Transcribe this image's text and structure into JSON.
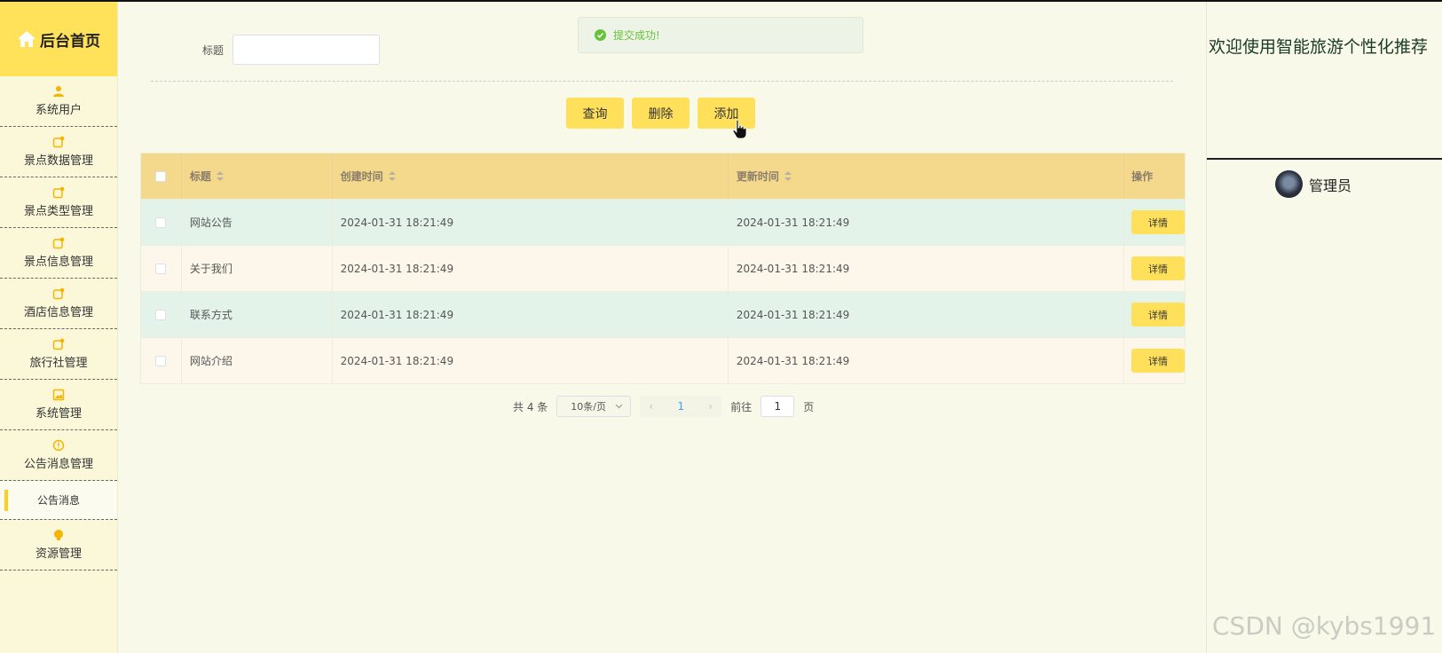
{
  "sidebar": {
    "brand": "后台首页",
    "items": [
      {
        "label": "系统用户",
        "icon": "user-icon"
      },
      {
        "label": "景点数据管理",
        "icon": "edit-icon"
      },
      {
        "label": "景点类型管理",
        "icon": "edit-icon"
      },
      {
        "label": "景点信息管理",
        "icon": "edit-icon"
      },
      {
        "label": "酒店信息管理",
        "icon": "edit-icon"
      },
      {
        "label": "旅行社管理",
        "icon": "edit-icon"
      },
      {
        "label": "系统管理",
        "icon": "image-icon"
      },
      {
        "label": "公告消息管理",
        "icon": "info-icon"
      }
    ],
    "active_sub": "公告消息",
    "last_item": {
      "label": "资源管理",
      "icon": "bulb-icon"
    }
  },
  "search": {
    "label": "标题",
    "value": ""
  },
  "toast": {
    "text": "提交成功!",
    "icon": "success-check-icon"
  },
  "buttons": {
    "query": "查询",
    "delete": "删除",
    "add": "添加"
  },
  "table": {
    "headers": [
      "标题",
      "创建时间",
      "更新时间",
      "操作"
    ],
    "rows": [
      {
        "title": "网站公告",
        "created": "2024-01-31 18:21:49",
        "updated": "2024-01-31 18:21:49",
        "action": "详情"
      },
      {
        "title": "关于我们",
        "created": "2024-01-31 18:21:49",
        "updated": "2024-01-31 18:21:49",
        "action": "详情"
      },
      {
        "title": "联系方式",
        "created": "2024-01-31 18:21:49",
        "updated": "2024-01-31 18:21:49",
        "action": "详情"
      },
      {
        "title": "网站介绍",
        "created": "2024-01-31 18:21:49",
        "updated": "2024-01-31 18:21:49",
        "action": "详情"
      }
    ]
  },
  "pagination": {
    "total": "共 4 条",
    "page_size": "10条/页",
    "current": "1",
    "goto_prefix": "前往",
    "goto_value": "1",
    "goto_suffix": "页"
  },
  "header": {
    "welcome": "欢迎使用智能旅游个性化推荐",
    "user": "管理员"
  },
  "watermark": "CSDN @kybs1991",
  "colors": {
    "accent": "#ffe05a",
    "header_row": "#f4d98d",
    "row_odd": "#e4f3ea",
    "row_even": "#fcf7ea",
    "sidebar": "#faf8d9",
    "success": "#67c23a"
  }
}
